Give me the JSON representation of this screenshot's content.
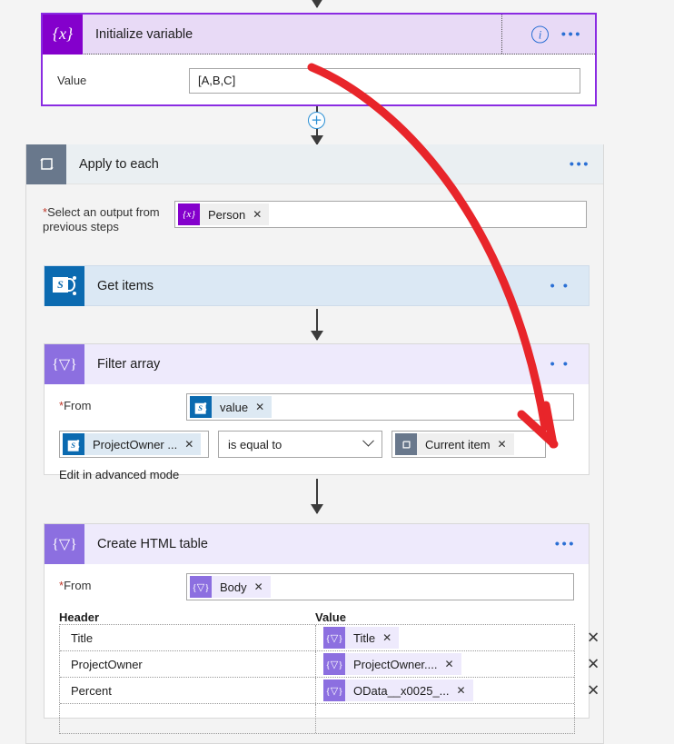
{
  "flow": {
    "initialize_variable": {
      "title": "Initialize variable",
      "icon": "variable-braces-icon",
      "info_icon": "info-icon",
      "menu_icon": "more-options-icon",
      "field_label": "Value",
      "field_value": "[A,B,C]"
    },
    "insert_button": {
      "label": "+",
      "icon": "add-step-plus-icon"
    },
    "apply_to_each": {
      "title": "Apply to each",
      "icon": "loop-foreach-icon",
      "menu_icon": "more-options-icon",
      "select_label_line1": "Select an output from",
      "select_label_line2": "previous steps",
      "required_marker": "*",
      "token": {
        "text": "Person",
        "icon": "variable-braces-icon",
        "remove": "✕"
      }
    },
    "get_items": {
      "title": "Get items",
      "icon": "sharepoint-icon",
      "menu_icon": "more-options-icon"
    },
    "filter_array": {
      "title": "Filter array",
      "icon": "filter-braces-icon",
      "menu_icon": "more-options-icon",
      "from_label": "From",
      "required_marker": "*",
      "from_token": {
        "text": "value",
        "icon": "sharepoint-icon",
        "remove": "✕"
      },
      "condition": {
        "left_token": {
          "text": "ProjectOwner ...",
          "icon": "sharepoint-icon",
          "remove": "✕"
        },
        "operator": "is equal to",
        "operator_icon": "chevron-down-icon",
        "right_token": {
          "text": "Current item",
          "icon": "loop-foreach-icon",
          "remove": "✕"
        }
      },
      "advanced_link": "Edit in advanced mode"
    },
    "create_html_table": {
      "title": "Create HTML table",
      "icon": "filter-braces-icon",
      "menu_icon": "more-options-icon",
      "from_label": "From",
      "required_marker": "*",
      "from_token": {
        "text": "Body",
        "icon": "filter-braces-icon",
        "remove": "✕"
      },
      "columns": {
        "header": "Header",
        "value": "Value"
      },
      "rows": [
        {
          "header": "Title",
          "token": "Title",
          "token_icon": "filter-braces-icon",
          "remove": "✕",
          "delete": "✕"
        },
        {
          "header": "ProjectOwner",
          "token": "ProjectOwner....",
          "token_icon": "filter-braces-icon",
          "remove": "✕",
          "delete": "✕"
        },
        {
          "header": "Percent",
          "token": "OData__x0025_...",
          "token_icon": "filter-braces-icon",
          "remove": "✕",
          "delete": "✕"
        },
        {
          "header": "",
          "token": "",
          "token_icon": "",
          "remove": "",
          "delete": ""
        }
      ]
    }
  },
  "annotation": {
    "type": "red-curved-arrow",
    "description": "arrow drawn from Value field to Current item token",
    "color": "#e8252a"
  },
  "colors": {
    "variable_purple": "#8400cc",
    "filter_purple": "#8c6fe0",
    "loop_slate": "#69788c",
    "sharepoint_blue": "#0b6ab0",
    "card_border_purple": "#8a2be2",
    "link_blue": "#2a6fd4",
    "annotation_red": "#e8252a"
  }
}
